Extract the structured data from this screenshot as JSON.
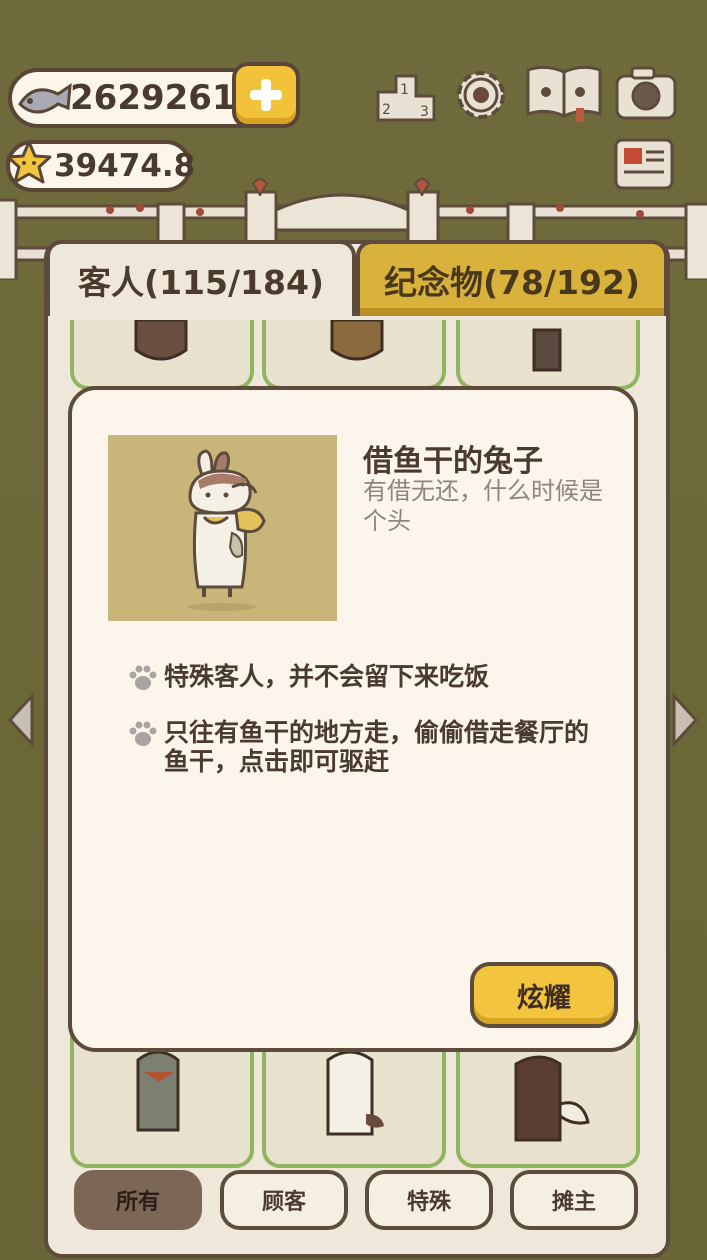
{
  "currency": {
    "fish_amount": "2629261",
    "star_amount": "39474.8"
  },
  "top_icons": [
    "leaderboard-icon",
    "settings-gear-icon",
    "paw-book-icon",
    "camera-icon",
    "newspaper-icon"
  ],
  "tabs": {
    "guests_label": "客人(115/184)",
    "souvenirs_label": "纪念物(78/192)"
  },
  "filters": {
    "all": "所有",
    "customers": "顾客",
    "special": "特殊",
    "vendors": "摊主",
    "selected": "所有"
  },
  "detail": {
    "name": "借鱼干的兔子",
    "description": "有借无还，什么时候是个头",
    "traits": [
      "特殊客人，并不会留下来吃饭",
      "只往有鱼干的地方走，偷偷借走餐厅的鱼干，点击即可驱赶"
    ],
    "show_button": "炫耀"
  },
  "colors": {
    "accent_yellow": "#f3c43e",
    "outline_brown": "#5d4b3c",
    "cell_green": "#8fb561",
    "background_olive": "#6e6a3a"
  }
}
